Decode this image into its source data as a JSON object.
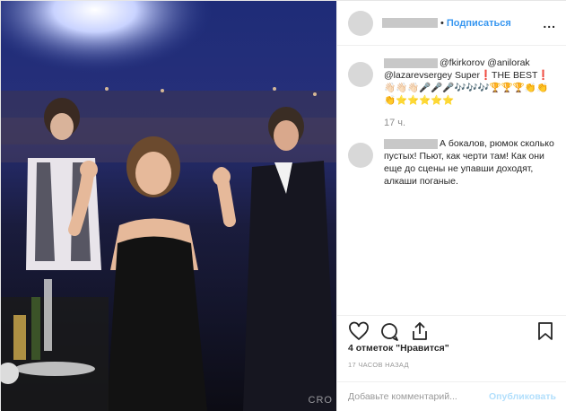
{
  "header": {
    "follow_label": "Подписаться",
    "dot": "•",
    "more": "..."
  },
  "caption": {
    "text": "@fkirkorov @anilorak @lazarevsergey Super❗THE BEST❗👋🏻👋🏻👋🏻🎤🎤🎤🎶🎶🎶🏆🏆🏆👏👏👏⭐⭐⭐⭐⭐",
    "time": "17 ч."
  },
  "comment": {
    "text": "А бокалов, рюмок сколько пустых! Пьют, как черти там! Как они еще до сцены не упавши доходят, алкаши поганые."
  },
  "likes": "4 отметок \"Нравится\"",
  "timestamp": "17 ЧАСОВ НАЗАД",
  "add_comment": {
    "placeholder": "Добавьте комментарий...",
    "publish_label": "Опубликовать"
  },
  "photo": {
    "watermark": "CRO"
  },
  "icons": [
    "heart-icon",
    "comment-icon",
    "share-icon",
    "bookmark-icon",
    "more-icon"
  ],
  "colors": {
    "link": "#3897f0",
    "publish_disabled": "#b2dffc",
    "muted": "#8e8e8e"
  }
}
